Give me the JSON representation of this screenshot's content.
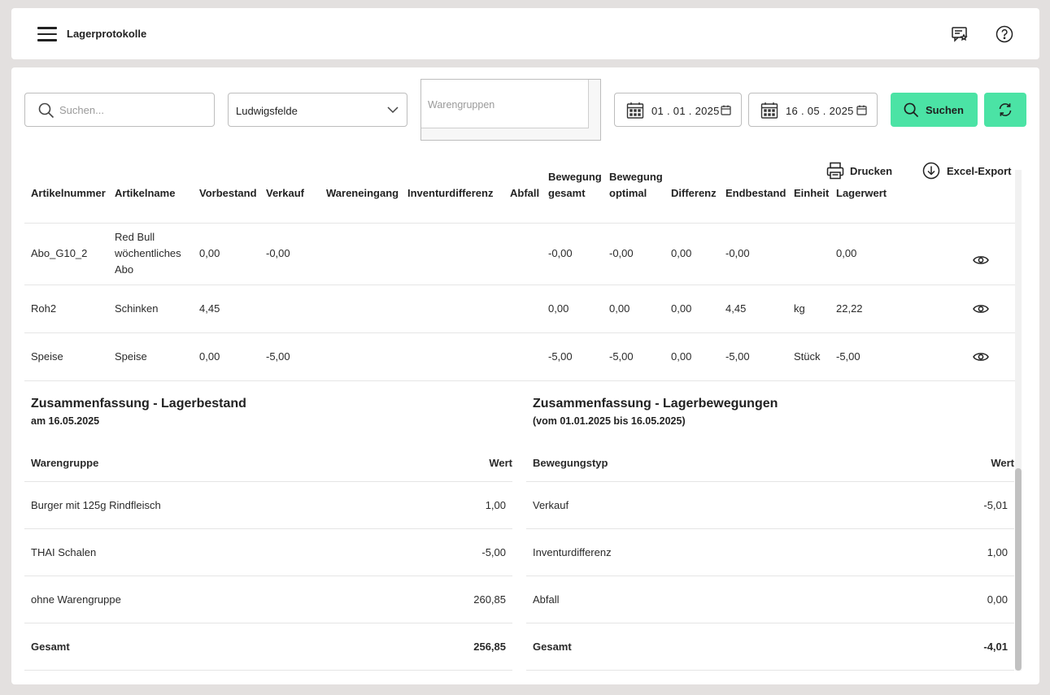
{
  "header": {
    "title": "Lagerprotokolle"
  },
  "filters": {
    "search_placeholder": "Suchen...",
    "location": "Ludwigsfelde",
    "warengruppen_placeholder": "Warengruppen",
    "date_from": "01 . 01 . 2025",
    "date_to": "16 . 05 . 2025",
    "search_button": "Suchen"
  },
  "actions": {
    "print": "Drucken",
    "export": "Excel-Export"
  },
  "table": {
    "headers": {
      "artikelnummer": "Artikelnummer",
      "artikelname": "Artikelname",
      "vorbestand": "Vorbestand",
      "verkauf": "Verkauf",
      "wareneingang": "Wareneingang",
      "inventurdifferenz": "Inventurdifferenz",
      "abfall": "Abfall",
      "bewegung_gesamt_1": "Bewegung",
      "bewegung_gesamt_2": "gesamt",
      "bewegung_optimal_1": "Bewegung",
      "bewegung_optimal_2": "optimal",
      "differenz": "Differenz",
      "endbestand": "Endbestand",
      "einheit": "Einheit",
      "lagerwert": "Lagerwert"
    },
    "rows": [
      {
        "artikelnummer": "Abo_G10_2",
        "name_1": "Red Bull",
        "name_2": "wöchentliches",
        "name_3": "Abo",
        "vorbestand": "0,00",
        "verkauf": "-0,00",
        "bewegung_gesamt": "-0,00",
        "bewegung_optimal": "-0,00",
        "differenz": "0,00",
        "endbestand": "-0,00",
        "einheit": "",
        "lagerwert": "0,00"
      },
      {
        "artikelnummer": "Roh2",
        "name_1": "Schinken",
        "vorbestand": "4,45",
        "verkauf": "",
        "bewegung_gesamt": "0,00",
        "bewegung_optimal": "0,00",
        "differenz": "0,00",
        "endbestand": "4,45",
        "einheit": "kg",
        "lagerwert": "22,22"
      },
      {
        "artikelnummer": "Speise",
        "name_1": "Speise",
        "vorbestand": "0,00",
        "verkauf": "-5,00",
        "bewegung_gesamt": "-5,00",
        "bewegung_optimal": "-5,00",
        "differenz": "0,00",
        "endbestand": "-5,00",
        "einheit": "Stück",
        "lagerwert": "-5,00"
      }
    ]
  },
  "summary_stock": {
    "title": "Zusammenfassung - Lagerbestand",
    "subtitle": "am 16.05.2025",
    "col_group": "Warengruppe",
    "col_value": "Wert",
    "rows": [
      {
        "label": "Burger mit 125g Rindfleisch",
        "value": "1,00"
      },
      {
        "label": "THAI Schalen",
        "value": "-5,00"
      },
      {
        "label": "ohne Warengruppe",
        "value": "260,85"
      }
    ],
    "total_label": "Gesamt",
    "total_value": "256,85"
  },
  "summary_movements": {
    "title": "Zusammenfassung - Lagerbewegungen",
    "subtitle": "(vom 01.01.2025 bis 16.05.2025)",
    "col_type": "Bewegungstyp",
    "col_value": "Wert",
    "rows": [
      {
        "label": "Verkauf",
        "value": "-5,01"
      },
      {
        "label": "Inventurdifferenz",
        "value": "1,00"
      },
      {
        "label": "Abfall",
        "value": "0,00"
      }
    ],
    "total_label": "Gesamt",
    "total_value": "-4,01"
  },
  "colors": {
    "accent": "#4be3a5",
    "background": "#e3e0df"
  }
}
